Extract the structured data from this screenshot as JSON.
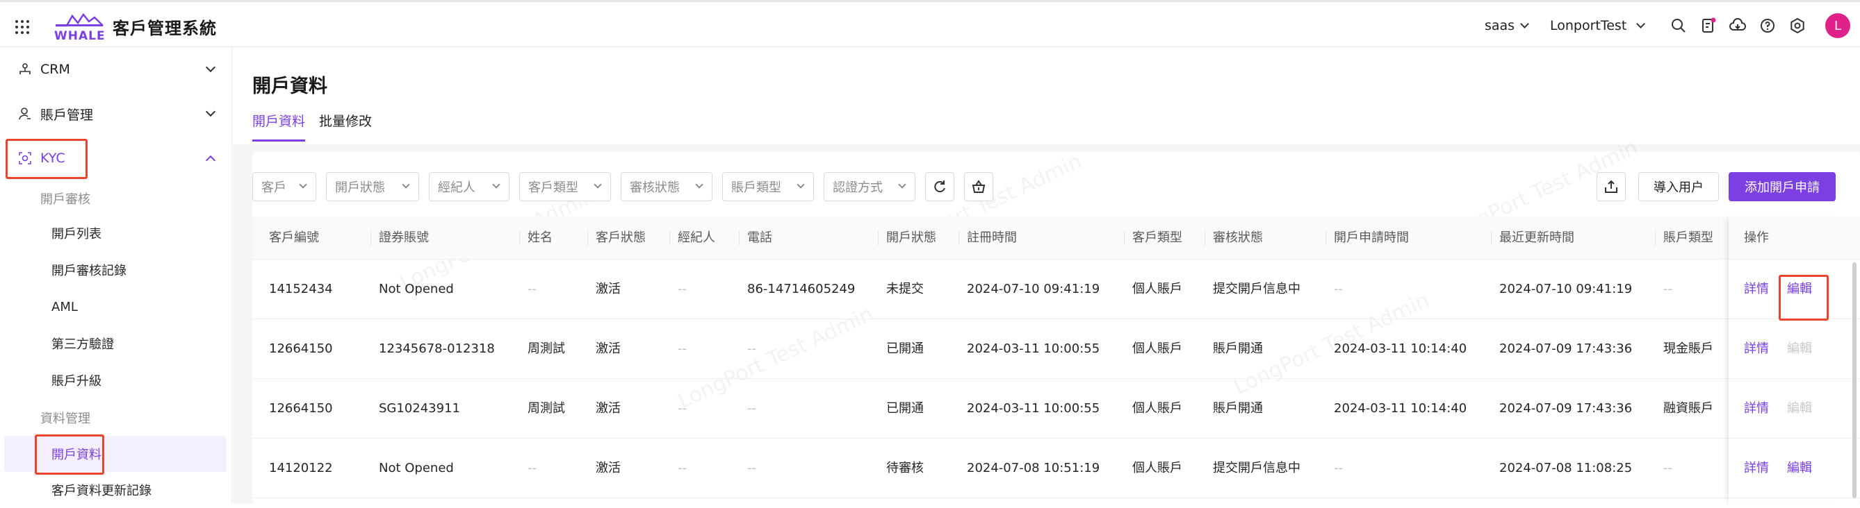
{
  "app": {
    "title": "客戶管理系統",
    "logo_text": "WHALE",
    "user_initial": "L"
  },
  "topbar": {
    "tenant": "saas",
    "org": "LonportTest"
  },
  "sidebar": {
    "menus": [
      {
        "label": "CRM"
      },
      {
        "label": "賬戶管理"
      },
      {
        "label": "KYC"
      }
    ],
    "groups": [
      {
        "title": "開戶審核",
        "items": [
          "開戶列表",
          "開戶審核記錄",
          "AML",
          "第三方驗證",
          "賬戶升級"
        ]
      },
      {
        "title": "資料管理",
        "items": [
          "開戶資料",
          "客戶資料更新記錄"
        ]
      }
    ]
  },
  "page": {
    "title": "開戶資料",
    "tabs": [
      "開戶資料",
      "批量修改"
    ]
  },
  "filters": [
    "客戶",
    "開戶狀態",
    "經紀人",
    "客戶類型",
    "審核狀態",
    "賬戶類型",
    "認證方式"
  ],
  "actions": {
    "import": "導入用户",
    "add": "添加開戶申請"
  },
  "watermark": "LongPort Test Admin",
  "table": {
    "columns": [
      "客戶編號",
      "證券賬號",
      "姓名",
      "客戶狀態",
      "經紀人",
      "電話",
      "開戶狀態",
      "註冊時間",
      "客戶類型",
      "審核狀態",
      "開戶申請時間",
      "最近更新時間",
      "賬戶類型"
    ],
    "ops_header": "操作",
    "rows": [
      [
        "14152434",
        "Not Opened",
        "--",
        "激活",
        "--",
        "86-14714605249",
        "未提交",
        "2024-07-10 09:41:19",
        "個人賬戶",
        "提交開戶信息中",
        "--",
        "2024-07-10 09:41:19",
        "--"
      ],
      [
        "12664150",
        "12345678-012318",
        "周測試",
        "激活",
        "--",
        "--",
        "已開通",
        "2024-03-11 10:00:55",
        "個人賬戶",
        "賬戶開通",
        "2024-03-11 10:14:40",
        "2024-07-09 17:43:36",
        "現金賬戶"
      ],
      [
        "12664150",
        "SG10243911",
        "周測試",
        "激活",
        "--",
        "--",
        "已開通",
        "2024-03-11 10:00:55",
        "個人賬戶",
        "賬戶開通",
        "2024-03-11 10:14:40",
        "2024-07-09 17:43:36",
        "融資賬戶"
      ],
      [
        "14120122",
        "Not Opened",
        "--",
        "激活",
        "--",
        "--",
        "待審核",
        "2024-07-08 10:51:19",
        "個人賬戶",
        "提交開戶信息中",
        "--",
        "2024-07-08 11:08:25",
        "--"
      ]
    ],
    "ops": [
      {
        "detail": "詳情",
        "edit": "編輯",
        "edit_enabled": true
      },
      {
        "detail": "詳情",
        "edit": "編輯",
        "edit_enabled": false
      },
      {
        "detail": "詳情",
        "edit": "編輯",
        "edit_enabled": false
      },
      {
        "detail": "詳情",
        "edit": "編輯",
        "edit_enabled": true
      }
    ]
  },
  "colors": {
    "accent": "#7b3fe4",
    "highlight": "#e8452c",
    "avatar": "#e0218a"
  }
}
